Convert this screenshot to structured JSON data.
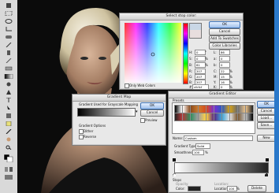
{
  "color_picker": {
    "title": "Select stop color:",
    "ok": "OK",
    "cancel": "Cancel",
    "add_to_swatches": "Add To Swatches",
    "color_libraries": "Color Libraries",
    "only_web_colors": "Only Web Colors",
    "fields": [
      {
        "label": "H:",
        "value": "0",
        "unit": "°",
        "label2": "L:",
        "value2": "86"
      },
      {
        "label": "S:",
        "value": "0",
        "unit": "%",
        "label2": "a:",
        "value2": "0"
      },
      {
        "label": "B:",
        "value": "81",
        "unit": "%",
        "label2": "b:",
        "value2": "0"
      },
      {
        "label": "R:",
        "value": "207",
        "unit": "",
        "label2": "C:",
        "value2": "22"
      },
      {
        "label": "G:",
        "value": "207",
        "unit": "",
        "label2": "M:",
        "value2": "15"
      },
      {
        "label": "B:",
        "value": "207",
        "unit": "",
        "label2": "Y:",
        "value2": "16"
      },
      {
        "label": "#",
        "value": "cfcfcf",
        "unit": "",
        "label2": "K:",
        "value2": "0"
      }
    ],
    "pct": "%"
  },
  "gradient_map": {
    "title": "Gradient Map",
    "group_label": "Gradient Used for Grayscale Mapping",
    "ok": "OK",
    "cancel": "Cancel",
    "preview": "Preview",
    "options_label": "Gradient Options",
    "dither": "Dither",
    "reverse": "Reverse"
  },
  "gradient_editor": {
    "title": "Gradient Editor",
    "presets": "Presets",
    "ok": "OK",
    "cancel": "Cancel",
    "load": "Load...",
    "save": "Save...",
    "name_label": "Name:",
    "name_value": "Custom",
    "new": "New",
    "type_label": "Gradient Type:",
    "type_value": "Solid",
    "smooth_label": "Smoothness:",
    "smooth_value": "100",
    "smooth_unit": "%",
    "stops_label": "Stops",
    "opacity": "Opacity:",
    "color": "Color:",
    "location": "Location:",
    "location_value": "100",
    "delete": "Delete",
    "pct": "%"
  },
  "colors": {
    "preset_swatches": [
      "#000000",
      "#ffffff",
      "#8a4a1c",
      "#c97b2f",
      "#d94c1a",
      "#7a2ed1",
      "#2b59c3",
      "#d4a017",
      "#6d6d6d",
      "#e8c08a",
      "#222222",
      "#b33b3b",
      "#2f8c5a",
      "#a0a0a0",
      "#ffd23f",
      "#5b2a86",
      "#3ea6d8",
      "#e3e3e3",
      "#7c5a34",
      "#c0c0c0"
    ]
  }
}
